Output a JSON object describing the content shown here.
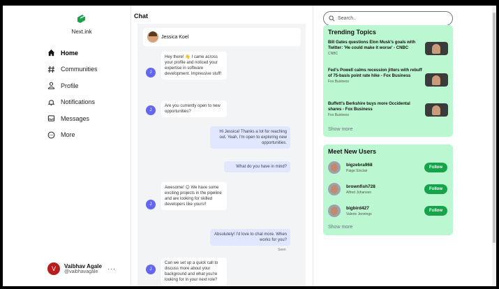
{
  "brand": {
    "name": "Next.ink"
  },
  "nav": [
    {
      "label": "Home",
      "icon": "home-icon",
      "active": true
    },
    {
      "label": "Communities",
      "icon": "hash-icon"
    },
    {
      "label": "Profile",
      "icon": "person-icon"
    },
    {
      "label": "Notifications",
      "icon": "bell-icon"
    },
    {
      "label": "Messages",
      "icon": "message-icon"
    },
    {
      "label": "More",
      "icon": "more-circle-icon"
    }
  ],
  "profile": {
    "initial": "V",
    "name": "Vaibhav Agale",
    "handle": "@vaibhavagale",
    "more": "···"
  },
  "chat": {
    "title": "Chat",
    "contact": "Jessica Koel",
    "incoming_initial": "J",
    "messages": [
      {
        "side": "in",
        "text": "Hey there! 👋 I came across your profile and noticed your expertise in software development. Impressive stuff!"
      },
      {
        "side": "in",
        "text": "Are you currently open to new opportunities?"
      },
      {
        "side": "out",
        "text": "Hi Jessica! Thanks a lot for reaching out. Yeah, I'm open to exploring new opportunities."
      },
      {
        "side": "out",
        "text": "What do you have in mind?"
      },
      {
        "side": "in",
        "text": "Awesome! 😊 We have some exciting projects in the pipeline and are looking for skilled developers like yours!!"
      },
      {
        "side": "out",
        "text": "Absolutely! I'd love to chat more. When works for you?"
      },
      {
        "side": "in",
        "text": "Can we set up a quick call to discuss more about your background and what you're looking for in your next role?"
      }
    ],
    "seen": "Seen"
  },
  "search": {
    "placeholder": "Search.."
  },
  "trending": {
    "title": "Trending Topics",
    "items": [
      {
        "title": "Bill Gates questions Elon Musk's goals with Twitter: 'He could make it worse' - CNBC",
        "source": "CNBC"
      },
      {
        "title": "Fed's Powell calms recession jitters with rebuff of 75-basis point rate hike - Fox Business",
        "source": "Fox Business"
      },
      {
        "title": "Buffett's Berkshire buys more Occidental shares - Fox Business",
        "source": "Fox Business"
      }
    ],
    "show_more": "Show more"
  },
  "users": {
    "title": "Meet New Users",
    "items": [
      {
        "username": "bigzebra968",
        "name": "Paige Sinclair",
        "button": "Follow"
      },
      {
        "username": "brownfish728",
        "name": "Alfred Johansen",
        "button": "Follow"
      },
      {
        "username": "bigbird427",
        "name": "Valerie Jennings",
        "button": "Follow"
      }
    ],
    "show_more": "Show more"
  },
  "colors": {
    "accent_green": "#16a34a",
    "card_green": "#bbf7d0",
    "outgoing_bubble": "#e0e7ff",
    "avatar_indigo": "#6366f1"
  }
}
